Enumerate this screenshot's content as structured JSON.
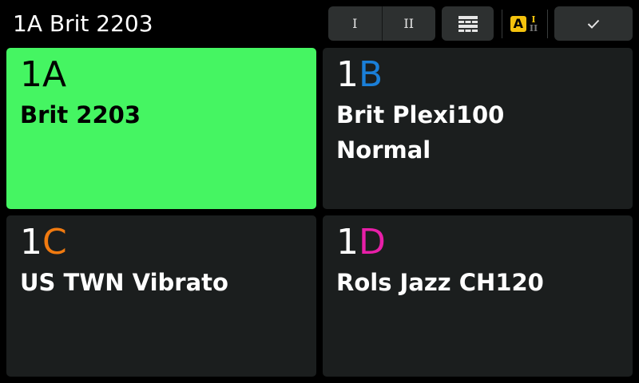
{
  "header": {
    "title": "1A Brit 2203"
  },
  "toolbar": {
    "seg_one_label": "I",
    "seg_two_label": "II",
    "grid_icon": "grid-layout-icon",
    "ab_icon": {
      "letter": "A",
      "top_roman": "I",
      "bottom_roman": "II",
      "accent": "#f4c20d"
    },
    "confirm_icon": "check-icon"
  },
  "tiles": [
    {
      "bank": "1",
      "slot": "A",
      "name": "Brit 2203",
      "slot_color": "#000000",
      "active": true
    },
    {
      "bank": "1",
      "slot": "B",
      "name": "Brit Plexi100\nNormal",
      "slot_color": "#1a7fd8",
      "active": false
    },
    {
      "bank": "1",
      "slot": "C",
      "name": "US TWN Vibrato",
      "slot_color": "#f07a10",
      "active": false
    },
    {
      "bank": "1",
      "slot": "D",
      "name": "Rols Jazz CH120",
      "slot_color": "#e81fa8",
      "active": false
    }
  ],
  "colors": {
    "background": "#000000",
    "tile": "#1b1e1e",
    "active_tile": "#45f562",
    "toolbar_button": "#2d3030"
  }
}
